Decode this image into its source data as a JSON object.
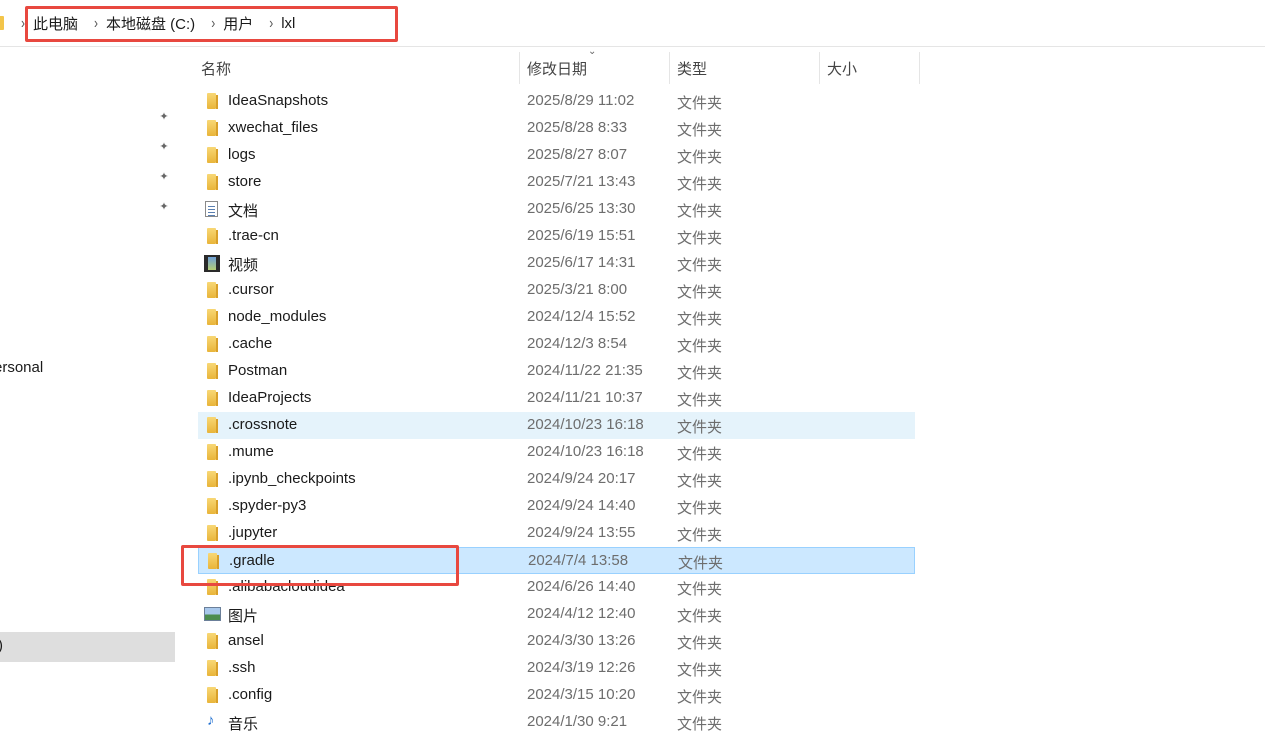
{
  "breadcrumb": [
    "此电脑",
    "本地磁盘 (C:)",
    "用户",
    "lxl"
  ],
  "nav": {
    "partial_label": "ersonal",
    "selected_partial_label": ")"
  },
  "columns": {
    "name": "名称",
    "date": "修改日期",
    "type": "类型",
    "size": "大小"
  },
  "files": [
    {
      "name": "IdeaSnapshots",
      "date": "2025/8/29 11:02",
      "type": "文件夹",
      "icon": "folder"
    },
    {
      "name": "xwechat_files",
      "date": "2025/8/28 8:33",
      "type": "文件夹",
      "icon": "folder"
    },
    {
      "name": "logs",
      "date": "2025/8/27 8:07",
      "type": "文件夹",
      "icon": "folder"
    },
    {
      "name": "store",
      "date": "2025/7/21 13:43",
      "type": "文件夹",
      "icon": "folder"
    },
    {
      "name": "文档",
      "date": "2025/6/25 13:30",
      "type": "文件夹",
      "icon": "documents"
    },
    {
      "name": ".trae-cn",
      "date": "2025/6/19 15:51",
      "type": "文件夹",
      "icon": "folder"
    },
    {
      "name": "视频",
      "date": "2025/6/17 14:31",
      "type": "文件夹",
      "icon": "videos"
    },
    {
      "name": ".cursor",
      "date": "2025/3/21 8:00",
      "type": "文件夹",
      "icon": "folder"
    },
    {
      "name": "node_modules",
      "date": "2024/12/4 15:52",
      "type": "文件夹",
      "icon": "folder"
    },
    {
      "name": ".cache",
      "date": "2024/12/3 8:54",
      "type": "文件夹",
      "icon": "folder"
    },
    {
      "name": "Postman",
      "date": "2024/11/22 21:35",
      "type": "文件夹",
      "icon": "folder"
    },
    {
      "name": "IdeaProjects",
      "date": "2024/11/21 10:37",
      "type": "文件夹",
      "icon": "folder"
    },
    {
      "name": ".crossnote",
      "date": "2024/10/23 16:18",
      "type": "文件夹",
      "icon": "folder",
      "state": "hover"
    },
    {
      "name": ".mume",
      "date": "2024/10/23 16:18",
      "type": "文件夹",
      "icon": "folder"
    },
    {
      "name": ".ipynb_checkpoints",
      "date": "2024/9/24 20:17",
      "type": "文件夹",
      "icon": "folder"
    },
    {
      "name": ".spyder-py3",
      "date": "2024/9/24 14:40",
      "type": "文件夹",
      "icon": "folder"
    },
    {
      "name": ".jupyter",
      "date": "2024/9/24 13:55",
      "type": "文件夹",
      "icon": "folder"
    },
    {
      "name": ".gradle",
      "date": "2024/7/4 13:58",
      "type": "文件夹",
      "icon": "folder",
      "state": "selected"
    },
    {
      "name": ".alibabacloudidea",
      "date": "2024/6/26 14:40",
      "type": "文件夹",
      "icon": "folder"
    },
    {
      "name": "图片",
      "date": "2024/4/12 12:40",
      "type": "文件夹",
      "icon": "pictures"
    },
    {
      "name": "ansel",
      "date": "2024/3/30 13:26",
      "type": "文件夹",
      "icon": "folder"
    },
    {
      "name": ".ssh",
      "date": "2024/3/19 12:26",
      "type": "文件夹",
      "icon": "folder"
    },
    {
      "name": ".config",
      "date": "2024/3/15 10:20",
      "type": "文件夹",
      "icon": "folder"
    },
    {
      "name": "音乐",
      "date": "2024/1/30 9:21",
      "type": "文件夹",
      "icon": "music"
    }
  ],
  "colors": {
    "highlight_box": "#e8483f",
    "selected_row": "#cce8ff",
    "hover_row": "#e5f3fb"
  }
}
